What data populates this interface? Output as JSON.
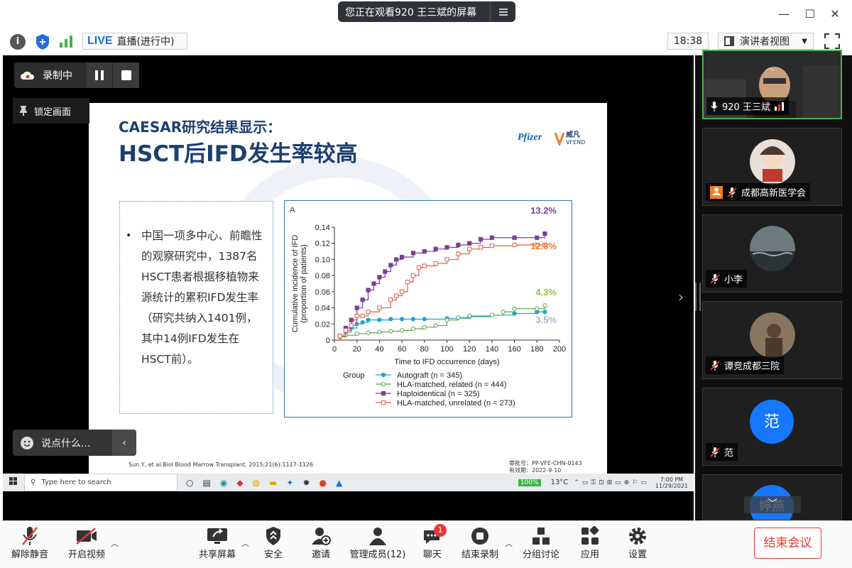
{
  "window": {
    "title": "您正在观看920 王三斌的屏幕"
  },
  "infobar": {
    "live_label": "LIVE",
    "live_status": "直播(进行中)",
    "time": "18:38",
    "view_mode": "演讲者视图"
  },
  "recording": {
    "label": "录制中",
    "lock_label": "锁定画面"
  },
  "chat": {
    "placeholder": "说点什么..."
  },
  "slide": {
    "title_line1": "CAESAR研究结果显示：",
    "title_line2": "HSCT后IFD发生率较高",
    "logo_left": "Pfizer",
    "logo_right": "威凡",
    "logo_right_sub": "VFEND",
    "bullet": "中国一项多中心、前瞻性的观察研究中，1387名HSCT患者根据移植物来源统计的累积IFD发生率（研究共纳入1401例，其中14例IFD发生在HSCT前）。",
    "citation": "Sun Y, et al.Biol Blood Marrow Transplant. 2015;21(6):1117-1126",
    "approval_line1": "审批号：PP-VFE-CHN-0143",
    "approval_line2": "有效期：2022-9-10",
    "panel_label": "A"
  },
  "chart_data": {
    "type": "line",
    "xlabel": "Time to IFD occurrence (days)",
    "ylabel": "Cumulative incidence of IFD (proportion of patients)",
    "xlim": [
      0,
      200
    ],
    "ylim": [
      0,
      0.14
    ],
    "xticks": [
      0,
      20,
      40,
      60,
      80,
      100,
      120,
      140,
      160,
      180,
      200
    ],
    "yticks": [
      0,
      0.02,
      0.04,
      0.06,
      0.08,
      0.1,
      0.12,
      0.14
    ],
    "legend_title": "Group",
    "legend_position": "bottom",
    "series": [
      {
        "name": "Autograft (n = 345)",
        "color": "#1fa3d6",
        "marker": "circle-filled",
        "end_label": "3.5%",
        "end_label_color": "#a9b4c9",
        "x": [
          0,
          5,
          10,
          15,
          20,
          25,
          30,
          40,
          50,
          60,
          70,
          80,
          100,
          120,
          140,
          160,
          180,
          187
        ],
        "y": [
          0,
          0.005,
          0.01,
          0.015,
          0.02,
          0.022,
          0.025,
          0.025,
          0.026,
          0.026,
          0.026,
          0.026,
          0.027,
          0.029,
          0.031,
          0.033,
          0.035,
          0.035
        ]
      },
      {
        "name": "HLA-matched, related (n = 444)",
        "color": "#58a846",
        "marker": "circle-open",
        "end_label": "4.3%",
        "end_label_color": "#8cc63f",
        "x": [
          0,
          5,
          10,
          20,
          30,
          40,
          50,
          60,
          70,
          80,
          90,
          100,
          110,
          120,
          140,
          150,
          160,
          180,
          187
        ],
        "y": [
          0,
          0.004,
          0.006,
          0.008,
          0.009,
          0.01,
          0.011,
          0.012,
          0.014,
          0.016,
          0.018,
          0.025,
          0.028,
          0.03,
          0.031,
          0.035,
          0.039,
          0.039,
          0.043
        ]
      },
      {
        "name": "Haploidentical (n = 325)",
        "color": "#7b3f98",
        "marker": "square-filled",
        "end_label": "13.2%",
        "end_label_color": "#7b3f98",
        "x": [
          0,
          5,
          10,
          15,
          20,
          25,
          30,
          35,
          40,
          45,
          50,
          55,
          60,
          70,
          80,
          90,
          100,
          110,
          120,
          130,
          140,
          160,
          180,
          187
        ],
        "y": [
          0,
          0.005,
          0.015,
          0.025,
          0.04,
          0.05,
          0.062,
          0.07,
          0.078,
          0.085,
          0.093,
          0.1,
          0.103,
          0.108,
          0.11,
          0.113,
          0.115,
          0.118,
          0.12,
          0.125,
          0.127,
          0.127,
          0.127,
          0.132
        ]
      },
      {
        "name": "HLA-matched, unrelated (n = 273)",
        "color": "#e0604a",
        "marker": "square-open",
        "end_label": "12.8%",
        "end_label_color": "#f07c2a",
        "x": [
          0,
          5,
          10,
          15,
          20,
          25,
          30,
          40,
          50,
          55,
          60,
          65,
          70,
          75,
          80,
          90,
          100,
          110,
          120,
          130,
          140,
          160,
          180,
          187
        ],
        "y": [
          0,
          0.005,
          0.012,
          0.018,
          0.03,
          0.03,
          0.035,
          0.04,
          0.05,
          0.055,
          0.06,
          0.072,
          0.08,
          0.09,
          0.092,
          0.095,
          0.1,
          0.107,
          0.113,
          0.115,
          0.117,
          0.118,
          0.118,
          0.118
        ]
      }
    ]
  },
  "taskbar": {
    "search_placeholder": "Type here to search",
    "battery": "100%",
    "temperature": "13°C",
    "time": "7:00 PM",
    "date": "11/29/2021"
  },
  "participants": [
    {
      "name": "920 王三斌",
      "role": "speaker"
    },
    {
      "name": "成都高新医学会",
      "role": "host"
    },
    {
      "name": "小李"
    },
    {
      "name": "谭竞成都三院"
    },
    {
      "name": "范",
      "initial": "范"
    },
    {
      "name": "婷燕",
      "initial": "婷燕"
    }
  ],
  "toolbar": {
    "unmute": "解除静音",
    "start_video": "开启视频",
    "share": "共享屏幕",
    "security": "安全",
    "invite": "邀请",
    "participants": "管理成员(12)",
    "chat": "聊天",
    "chat_badge": "1",
    "stop_record": "结束录制",
    "breakout": "分组讨论",
    "apps": "应用",
    "settings": "设置",
    "end": "结束会议"
  },
  "colors": {
    "accent": "#1e6fd9",
    "end": "#e53935",
    "slide_title": "#1b3f73",
    "avatar_blue": "#1677ff"
  }
}
